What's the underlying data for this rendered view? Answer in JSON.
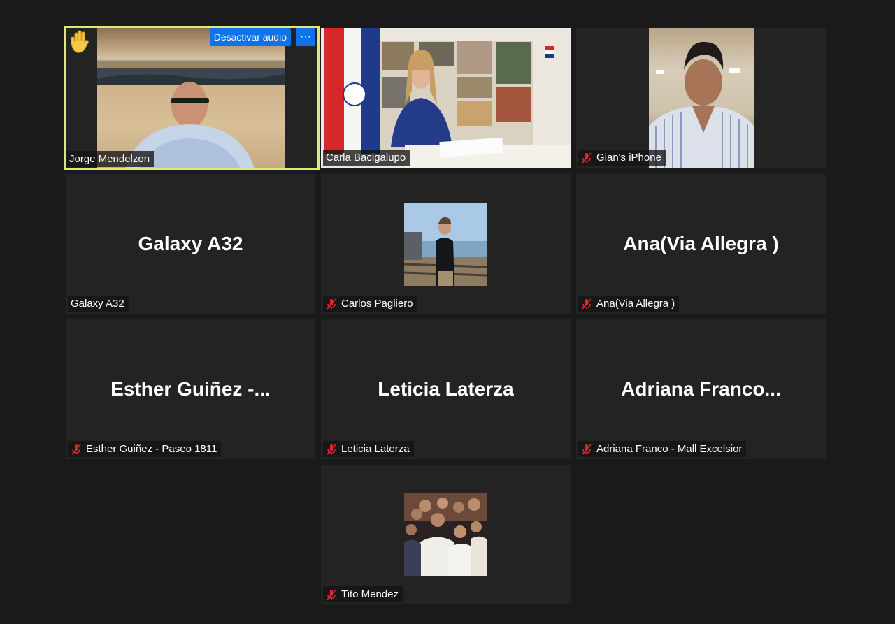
{
  "participants": [
    {
      "name": "Jorge Mendelzon"
    },
    {
      "name": "Carla Bacigalupo"
    },
    {
      "name": "Gian's iPhone"
    },
    {
      "name": "Galaxy A32",
      "display": "Galaxy A32"
    },
    {
      "name": "Carlos Pagliero"
    },
    {
      "name": "Ana(Via Allegra )",
      "display": "Ana(Via Allegra )"
    },
    {
      "name": "Esther Guiñez - Paseo 1811",
      "display": "Esther  Guiñez  -..."
    },
    {
      "name": "Leticia Laterza",
      "display": "Leticia Laterza"
    },
    {
      "name": "Adriana Franco - Mall Excelsior",
      "display": "Adriana  Franco..."
    },
    {
      "name": "Tito Mendez"
    }
  ],
  "controls": {
    "mute_button": "Desactivar audio",
    "more_button": "···"
  },
  "icons": {
    "raised_hand": "raised-hand-icon",
    "muted_mic": "muted-mic-icon"
  },
  "colors": {
    "active_speaker_border": "#dfe77a",
    "button_blue": "#0e72ed",
    "muted_red": "#e02828",
    "background": "#1a1a1a",
    "tile": "#232323"
  }
}
